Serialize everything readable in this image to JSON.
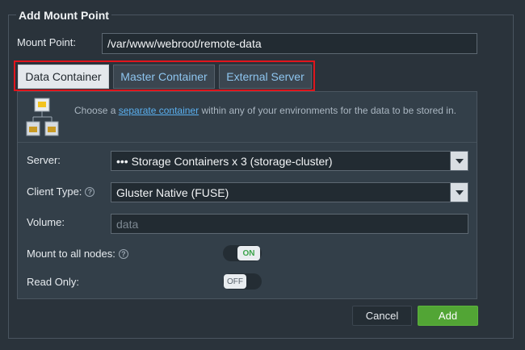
{
  "dialog": {
    "title": "Add Mount Point"
  },
  "mount_point": {
    "label": "Mount Point:",
    "value": "/var/www/webroot/remote-data"
  },
  "tabs": [
    {
      "label": "Data Container",
      "active": true
    },
    {
      "label": "Master Container",
      "active": false
    },
    {
      "label": "External Server",
      "active": false
    }
  ],
  "info": {
    "text_before": "Choose a ",
    "link": "separate container",
    "text_after": " within any of your environments for the data to be stored in.",
    "icon": "container-tree-icon"
  },
  "server": {
    "label": "Server:",
    "value": "••• Storage Containers x 3 (storage-cluster)"
  },
  "client_type": {
    "label": "Client Type:",
    "value": "Gluster Native (FUSE)"
  },
  "volume": {
    "label": "Volume:",
    "placeholder": "data"
  },
  "mount_all": {
    "label": "Mount to all nodes:",
    "state": "ON"
  },
  "read_only": {
    "label": "Read Only:",
    "state": "OFF"
  },
  "buttons": {
    "cancel": "Cancel",
    "add": "Add"
  },
  "colors": {
    "accent_link": "#5ab0f0",
    "add_button": "#52a535",
    "highlight": "#e0151c",
    "toggle_on": "#3aa34a"
  }
}
